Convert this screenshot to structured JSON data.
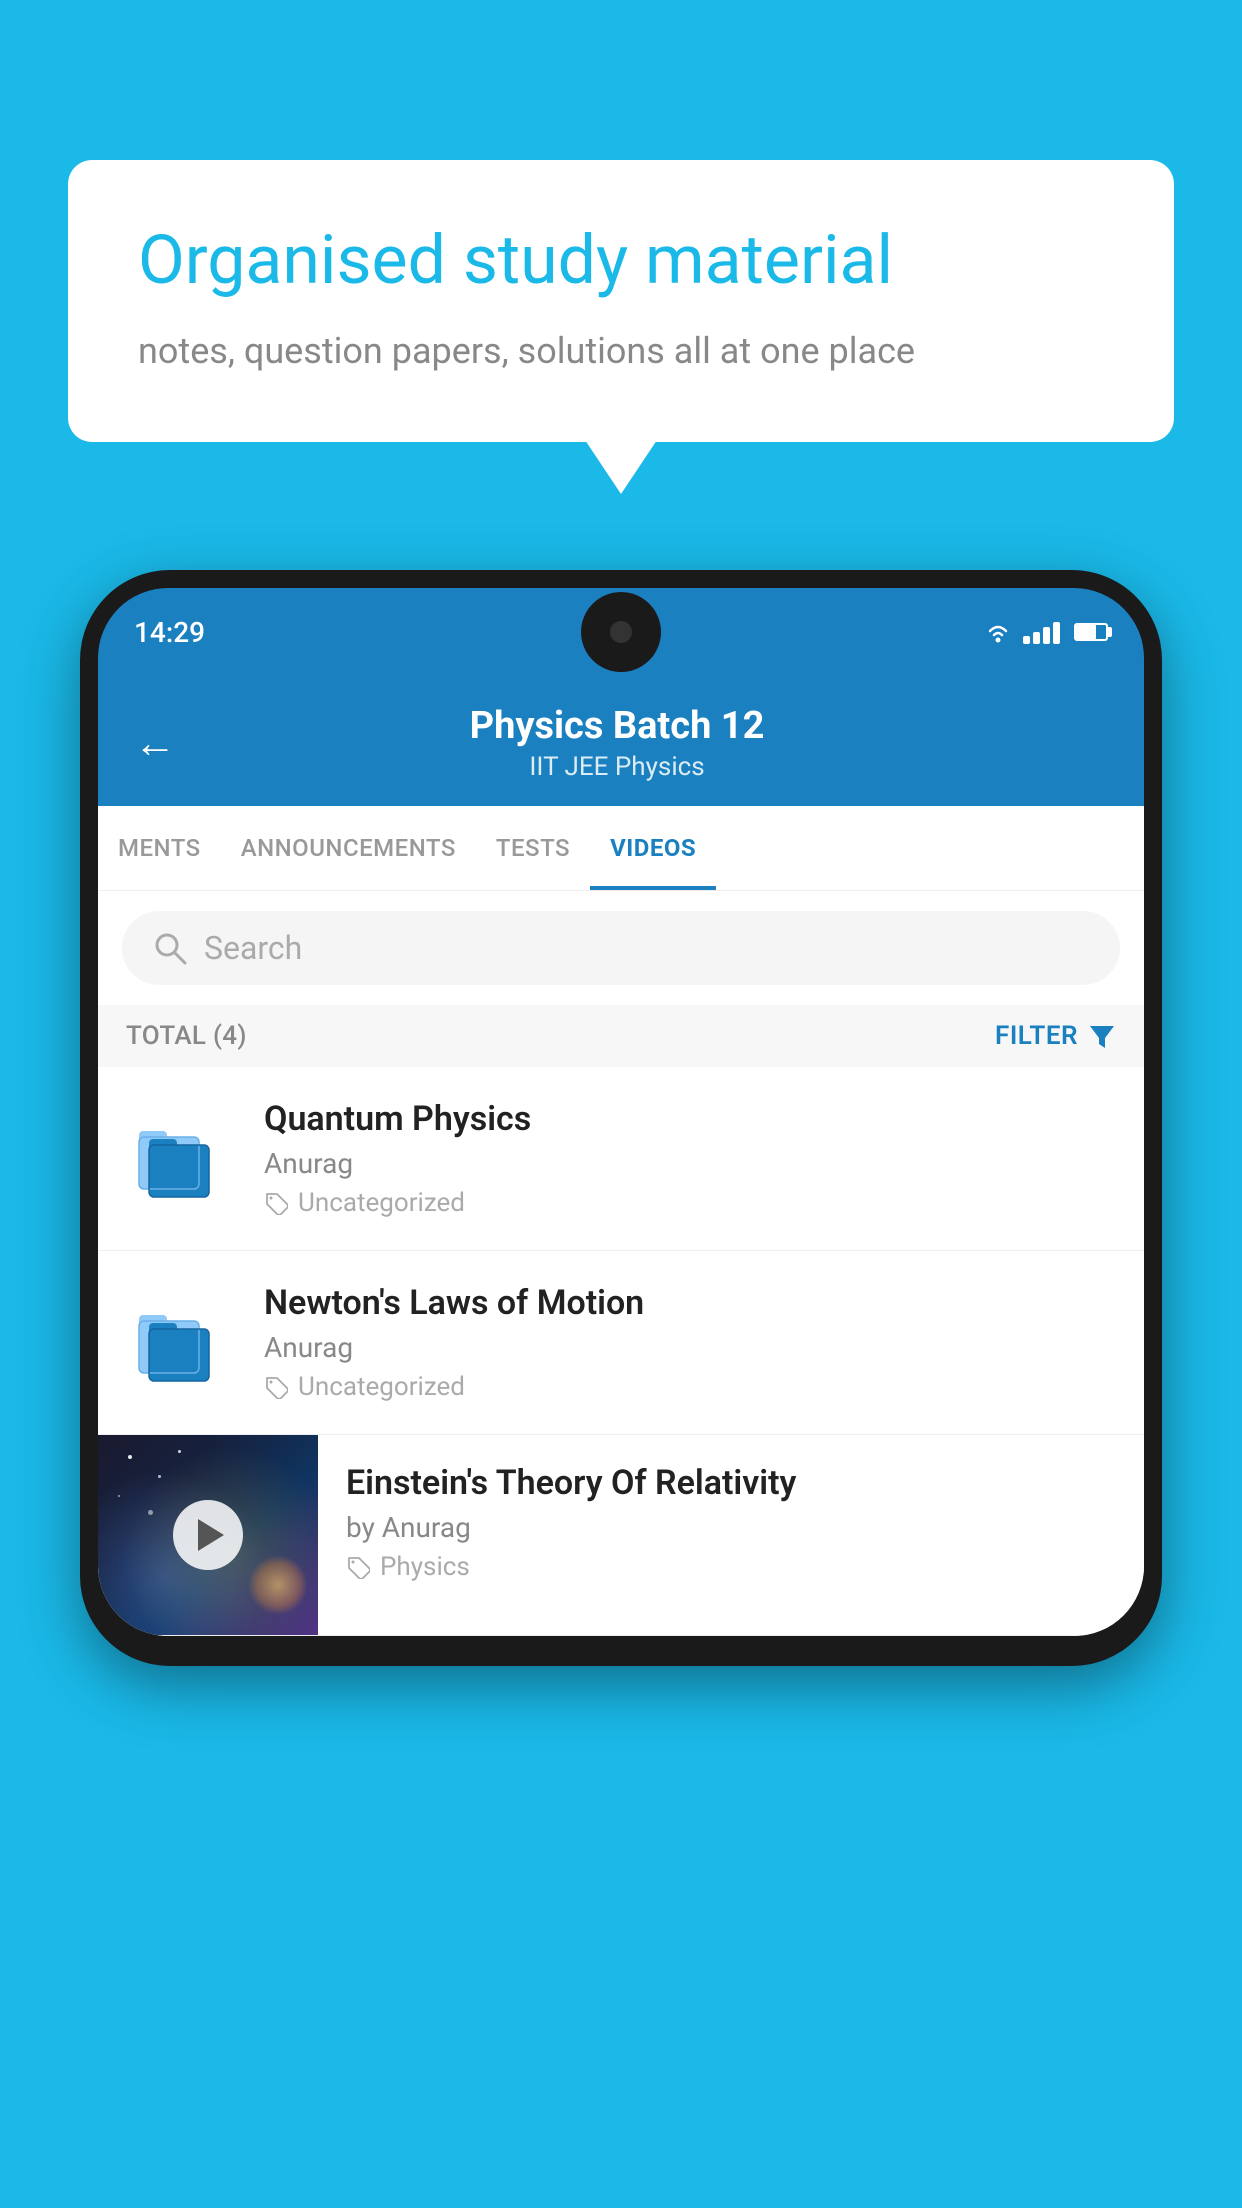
{
  "background_color": "#1ab9e8",
  "bubble": {
    "title": "Organised study material",
    "subtitle": "notes, question papers, solutions all at one place"
  },
  "status_bar": {
    "time": "14:29"
  },
  "app_header": {
    "title": "Physics Batch 12",
    "subtitle": "IIT JEE   Physics"
  },
  "tabs": [
    {
      "label": "MENTS",
      "active": false
    },
    {
      "label": "ANNOUNCEMENTS",
      "active": false
    },
    {
      "label": "TESTS",
      "active": false
    },
    {
      "label": "VIDEOS",
      "active": true
    }
  ],
  "search": {
    "placeholder": "Search"
  },
  "filter_row": {
    "total_label": "TOTAL (4)",
    "filter_label": "FILTER"
  },
  "videos": [
    {
      "title": "Quantum Physics",
      "author": "Anurag",
      "tag": "Uncategorized",
      "type": "folder"
    },
    {
      "title": "Newton's Laws of Motion",
      "author": "Anurag",
      "tag": "Uncategorized",
      "type": "folder"
    },
    {
      "title": "Einstein's Theory Of Relativity",
      "author": "by Anurag",
      "tag": "Physics",
      "type": "video"
    }
  ]
}
